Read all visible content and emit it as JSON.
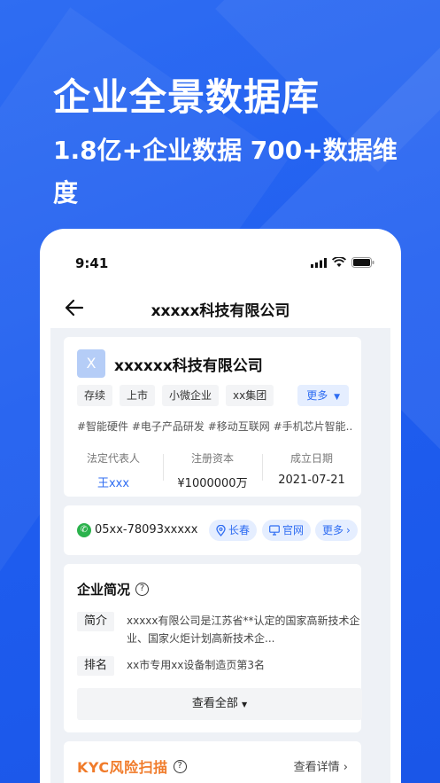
{
  "headline": "企业全景数据库",
  "subhead": "1.8亿+企业数据 700+数据维度",
  "status": {
    "time": "9:41"
  },
  "nav": {
    "title": "xxxxx科技有限公司"
  },
  "company": {
    "logo_letter": "X",
    "name": "xxxxxx科技有限公司",
    "tags": [
      "存续",
      "上市",
      "小微企业",
      "xx集团"
    ],
    "more": "更多",
    "hashtags": "#智能硬件 #电子产品研发 #移动互联网 #手机芯片智能...",
    "stats": [
      {
        "label": "法定代表人",
        "value": "王xxx"
      },
      {
        "label": "注册资本",
        "value": "¥1000000万"
      },
      {
        "label": "成立日期",
        "value": "2021-07-21"
      }
    ]
  },
  "contact": {
    "phone": "05xx-78093xxxxx",
    "city": "长春",
    "website": "官网",
    "more": "更多"
  },
  "profile": {
    "title": "企业简况",
    "intro_key": "简介",
    "intro_value": "xxxxx有限公司是江苏省**认定的国家高新技术企业、国家火炬计划高新技术企...",
    "rank_key": "排名",
    "rank_value": "xx市专用xx设备制造页第3名",
    "view_all": "查看全部"
  },
  "kyc": {
    "title": "KYC风险扫描",
    "detail": "查看详情"
  }
}
